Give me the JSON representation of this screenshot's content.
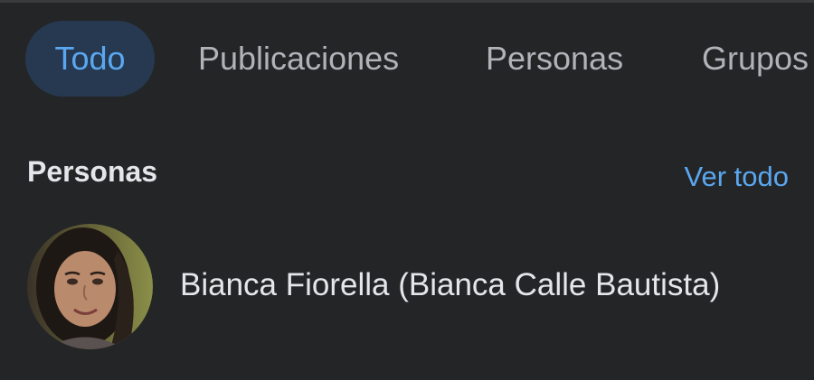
{
  "tabs": [
    {
      "label": "Todo",
      "active": true
    },
    {
      "label": "Publicaciones",
      "active": false
    },
    {
      "label": "Personas",
      "active": false
    },
    {
      "label": "Grupos",
      "active": false
    }
  ],
  "people_section": {
    "title": "Personas",
    "see_all_label": "Ver todo",
    "results": [
      {
        "name": "Bianca Fiorella (Bianca Calle Bautista)",
        "avatar": "profile-photo"
      }
    ]
  },
  "colors": {
    "background": "#242526",
    "active_tab_bg": "#263951",
    "accent": "#5aa7f0",
    "text_primary": "#e4e6eb",
    "text_secondary": "#b0b3b8"
  }
}
